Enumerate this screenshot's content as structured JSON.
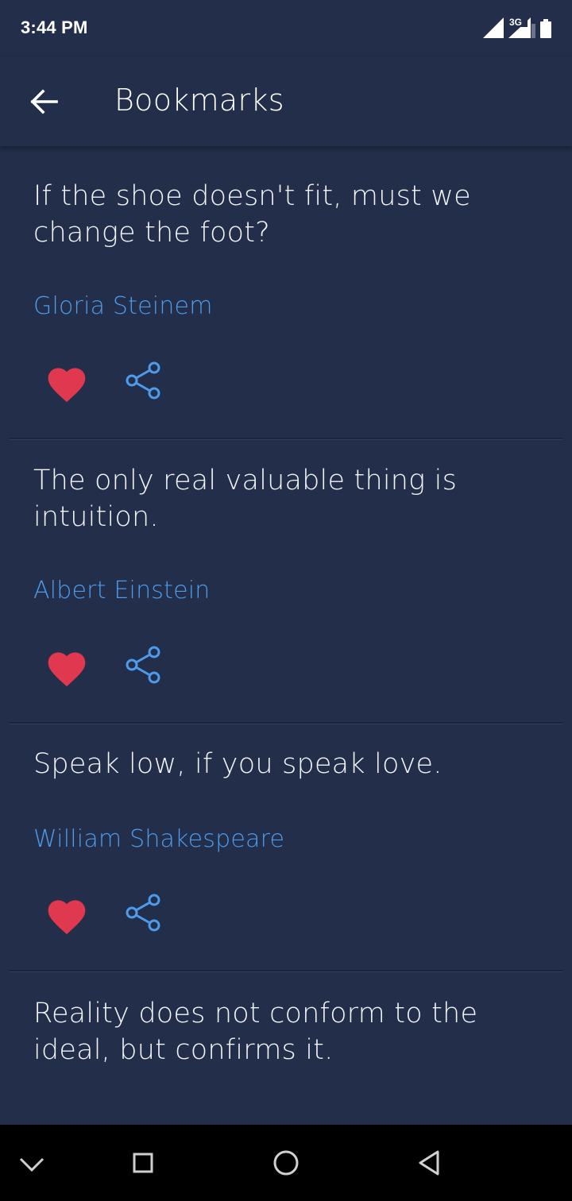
{
  "status_bar": {
    "time": "3:44 PM",
    "network": "3G",
    "icons": [
      "signal-icon",
      "network-3g-icon",
      "battery-icon"
    ]
  },
  "app_bar": {
    "title": "Bookmarks",
    "back_icon": "arrow-left-icon"
  },
  "quotes": [
    {
      "text": "If the shoe doesn't fit, must we change the foot?",
      "author": "Gloria Steinem",
      "liked": true
    },
    {
      "text": "The only real valuable thing is intuition.",
      "author": "Albert Einstein",
      "liked": true
    },
    {
      "text": "Speak low, if you speak love.",
      "author": "William Shakespeare",
      "liked": true
    },
    {
      "text": "Reality does not conform to the ideal, but confirms it.",
      "author": "",
      "liked": true
    }
  ],
  "colors": {
    "background": "#222e4a",
    "author": "#4d9bea",
    "heart": "#e0384e",
    "share": "#4d9bea",
    "nav_bar": "#000000"
  },
  "nav_bar": {
    "icons": [
      "chevron-down-icon",
      "square-icon",
      "circle-icon",
      "triangle-back-icon"
    ]
  }
}
